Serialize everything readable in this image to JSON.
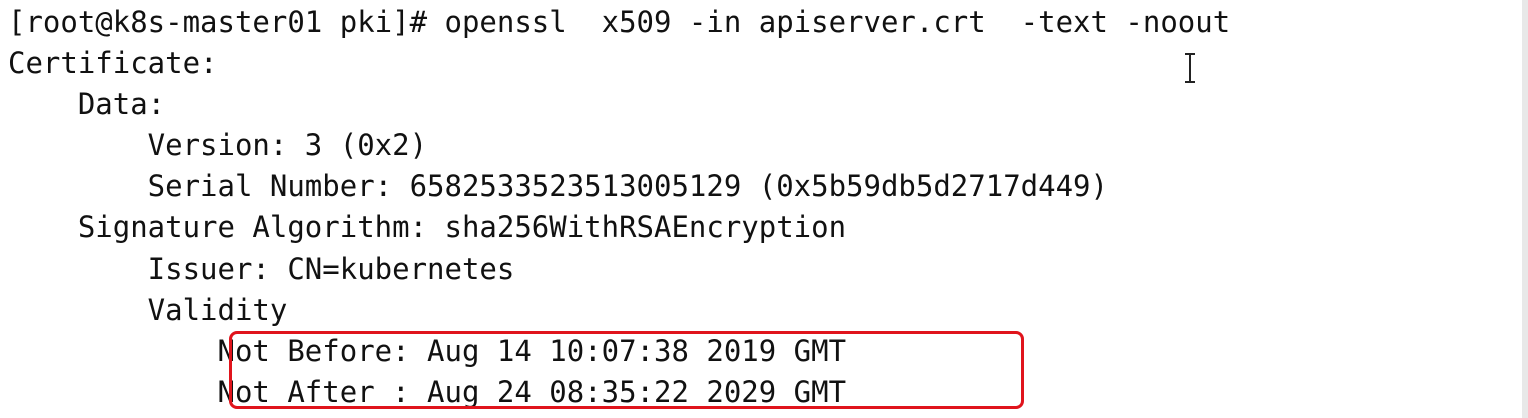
{
  "terminal": {
    "lines": [
      "[root@k8s-master01 pki]# openssl  x509 -in apiserver.crt  -text -noout",
      "Certificate:",
      "    Data:",
      "        Version: 3 (0x2)",
      "        Serial Number: 6582533523513005129 (0x5b59db5d2717d449)",
      "    Signature Algorithm: sha256WithRSAEncryption",
      "        Issuer: CN=kubernetes",
      "        Validity",
      "            Not Before: Aug 14 10:07:38 2019 GMT",
      "            Not After : Aug 24 08:35:22 2029 GMT"
    ],
    "cursor_icon": "text-cursor-icon"
  },
  "colors": {
    "background": "#ffffff",
    "text": "#111111",
    "highlight": "#e0141c"
  }
}
